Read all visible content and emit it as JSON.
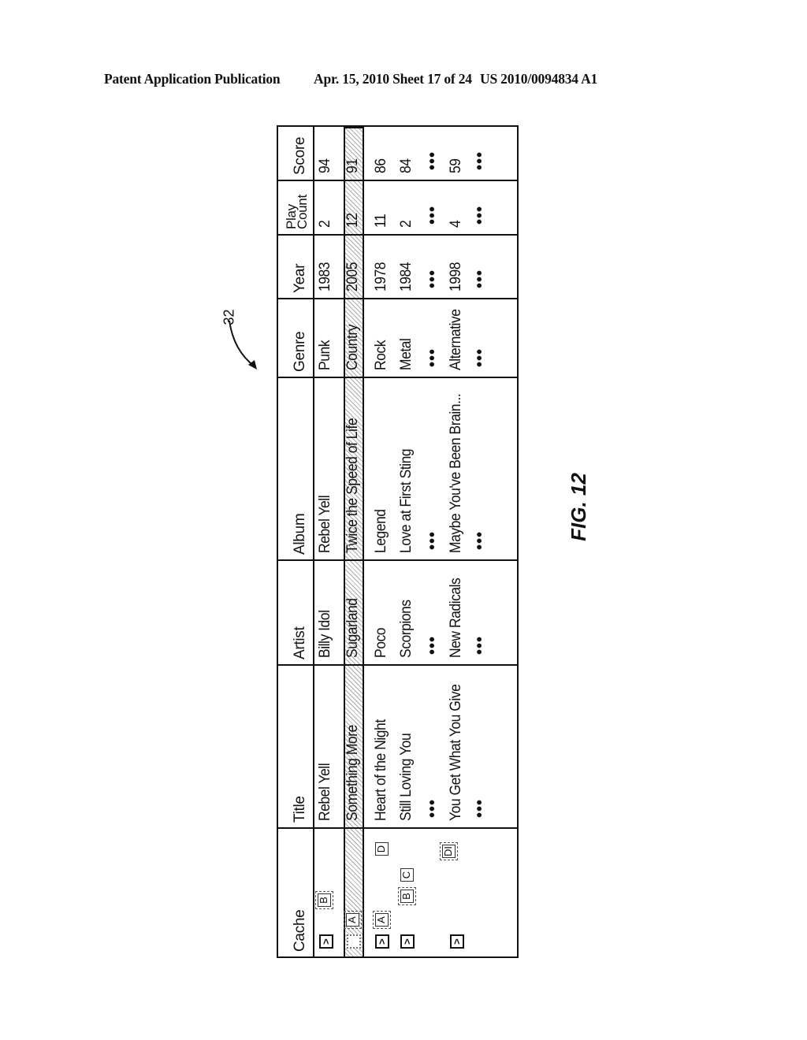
{
  "header": {
    "publication": "Patent Application Publication",
    "date_sheet": "Apr. 15, 2010  Sheet 17 of 24",
    "patent_number": "US 2010/0094834 A1"
  },
  "reference_numeral": "32",
  "figure_label": "FIG. 12",
  "table": {
    "columns": [
      "Cache",
      "Title",
      "Artist",
      "Album",
      "Genre",
      "Year",
      "Play Count",
      "Score"
    ],
    "play_count_lines": [
      "Play",
      "Count"
    ],
    "ellipsis": "•••",
    "rows": [
      {
        "checked": true,
        "check_glyph": ">",
        "tags": [
          "B"
        ],
        "title": "Rebel Yell",
        "artist": "Billy Idol",
        "album": "Rebel Yell",
        "genre": "Punk",
        "year": "1983",
        "play_count": "2",
        "score": "94",
        "highlighted": false
      },
      {
        "checked": false,
        "check_glyph": "",
        "tags": [
          "A"
        ],
        "title": "Something More",
        "artist": "Sugarland",
        "album": "Twice the Speed of Life",
        "genre": "Country",
        "year": "2005",
        "play_count": "12",
        "score": "91",
        "highlighted": true
      },
      {
        "checked": true,
        "check_glyph": ">",
        "tags": [
          "A",
          "D"
        ],
        "title": "Heart of the Night",
        "artist": "Poco",
        "album": "Legend",
        "genre": "Rock",
        "year": "1978",
        "play_count": "11",
        "score": "86",
        "highlighted": false
      },
      {
        "checked": true,
        "check_glyph": ">",
        "tags": [
          "B",
          "C"
        ],
        "title": "Still Loving You",
        "artist": "Scorpions",
        "album": "Love at First Sting",
        "genre": "Metal",
        "year": "1984",
        "play_count": "2",
        "score": "84",
        "highlighted": false
      },
      {
        "checked": true,
        "check_glyph": ">",
        "tags": [
          "DI"
        ],
        "title": "You Get What You Give",
        "artist": "New Radicals",
        "album": "Maybe You've Been Brain...",
        "genre": "Alternative",
        "year": "1998",
        "play_count": "4",
        "score": "59",
        "highlighted": false
      }
    ]
  }
}
